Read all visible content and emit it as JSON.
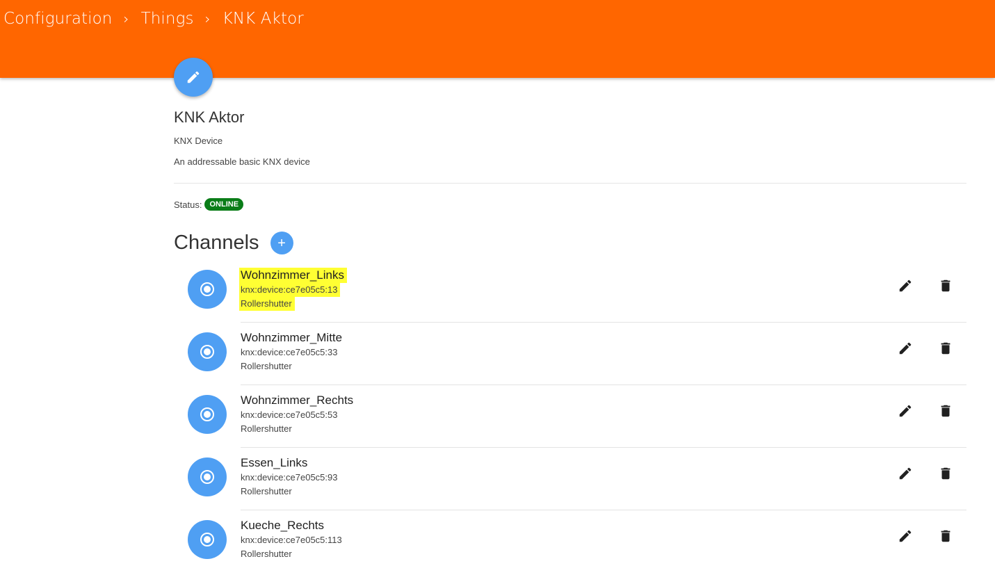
{
  "breadcrumb": {
    "items": [
      "Configuration",
      "Things",
      "KNK Aktor"
    ],
    "separator": "›"
  },
  "thing": {
    "title": "KNK Aktor",
    "type": "KNX Device",
    "description": "An addressable basic KNX device",
    "status_label": "Status:",
    "status": "ONLINE"
  },
  "channels": {
    "title": "Channels",
    "add_label": "+",
    "items": [
      {
        "name": "Wohnzimmer_Links",
        "uid": "knx:device:ce7e05c5:13",
        "type": "Rollershutter",
        "highlighted": true
      },
      {
        "name": "Wohnzimmer_Mitte",
        "uid": "knx:device:ce7e05c5:33",
        "type": "Rollershutter",
        "highlighted": false
      },
      {
        "name": "Wohnzimmer_Rechts",
        "uid": "knx:device:ce7e05c5:53",
        "type": "Rollershutter",
        "highlighted": false
      },
      {
        "name": "Essen_Links",
        "uid": "knx:device:ce7e05c5:93",
        "type": "Rollershutter",
        "highlighted": false
      },
      {
        "name": "Kueche_Rechts",
        "uid": "knx:device:ce7e05c5:113",
        "type": "Rollershutter",
        "highlighted": false
      }
    ]
  },
  "icons": {
    "edit_thing": "pencil-icon",
    "channel_avatar": "radio-button-checked-icon",
    "channel_edit": "pencil-icon",
    "channel_delete": "trash-icon"
  },
  "colors": {
    "header": "#ff6600",
    "accent": "#4f9ff3",
    "status_online": "#0a7d18",
    "highlight": "#ffff33"
  }
}
